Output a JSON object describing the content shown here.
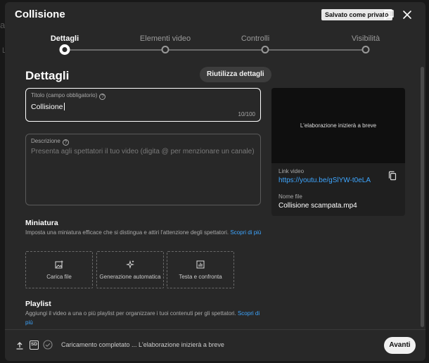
{
  "background": {
    "ghost_char": "a",
    "ghost_small": "L"
  },
  "dialog": {
    "title": "Collisione",
    "saved_badge": "Salvato come privato"
  },
  "stepper": {
    "steps": [
      {
        "label": "Dettagli",
        "active": true
      },
      {
        "label": "Elementi video",
        "active": false
      },
      {
        "label": "Controlli",
        "active": false
      },
      {
        "label": "Visibilità",
        "active": false
      }
    ]
  },
  "details": {
    "heading": "Dettagli",
    "reuse_button": "Riutilizza dettagli",
    "title_field": {
      "label": "Titolo (campo obbligatorio)",
      "value": "Collisione",
      "counter": "10/100"
    },
    "description_field": {
      "label": "Descrizione",
      "placeholder": "Presenta agli spettatori il tuo video (digita @ per menzionare un canale)"
    }
  },
  "preview": {
    "processing_text": "L'elaborazione inizierà a breve",
    "link_label": "Link video",
    "link": "https://youtu.be/gSlYW-t0eLA",
    "file_label": "Nome file",
    "file_name": "Collisione scampata.mp4"
  },
  "thumbnail": {
    "heading": "Miniatura",
    "text": "Imposta una miniatura efficace che si distingua e attiri l'attenzione degli spettatori.",
    "more_link": "Scopri di più",
    "options": [
      {
        "label": "Carica file",
        "icon": "image-upload-icon"
      },
      {
        "label": "Generazione automatica",
        "icon": "sparkle-icon"
      },
      {
        "label": "Testa e confronta",
        "icon": "chart-icon"
      }
    ]
  },
  "playlist": {
    "heading": "Playlist",
    "text": "Aggiungi il video a una o più playlist per organizzare i tuoi contenuti per gli spettatori.",
    "more_link": "Scopri di più"
  },
  "footer": {
    "sd_label": "SD",
    "status": "Caricamento completato ... L'elaborazione inizierà a breve",
    "next_button": "Avanti"
  },
  "colors": {
    "accent_link": "#3ea6ff",
    "dialog_bg": "#282828",
    "button_light": "#f1f1f1"
  }
}
